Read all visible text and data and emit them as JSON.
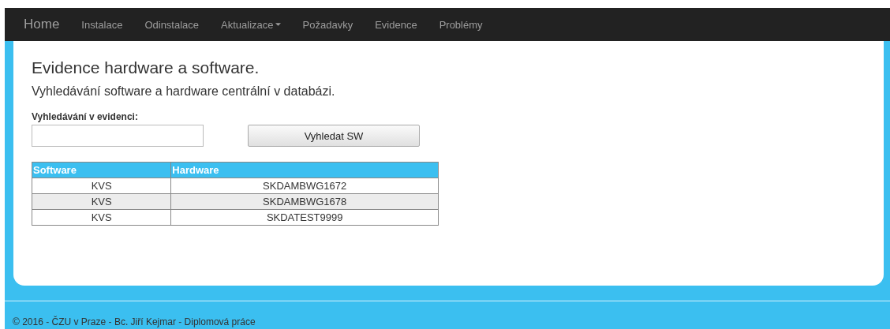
{
  "navbar": {
    "brand": "Home",
    "items": [
      {
        "label": "Instalace",
        "kind": "link"
      },
      {
        "label": "Odinstalace",
        "kind": "link"
      },
      {
        "label": "Aktualizace",
        "kind": "dropdown"
      },
      {
        "label": "Požadavky",
        "kind": "link"
      },
      {
        "label": "Evidence",
        "kind": "link"
      },
      {
        "label": "Problémy",
        "kind": "link"
      }
    ]
  },
  "page": {
    "title": "Evidence hardware a software.",
    "subtitle": "Vyhledávání software a hardware centrální v databázi.",
    "search_label": "Vyhledávání v evidenci:",
    "search_button": "Vyhledat SW"
  },
  "table": {
    "columns": [
      "Software",
      "Hardware"
    ],
    "rows": [
      [
        "KVS",
        "SKDAMBWG1672"
      ],
      [
        "KVS",
        "SKDAMBWG1678"
      ],
      [
        "KVS",
        "SKDATEST9999"
      ]
    ]
  },
  "footer": "© 2016 - ČZU v Praze - Bc. Jiří Kejmar - Diplomová práce"
}
